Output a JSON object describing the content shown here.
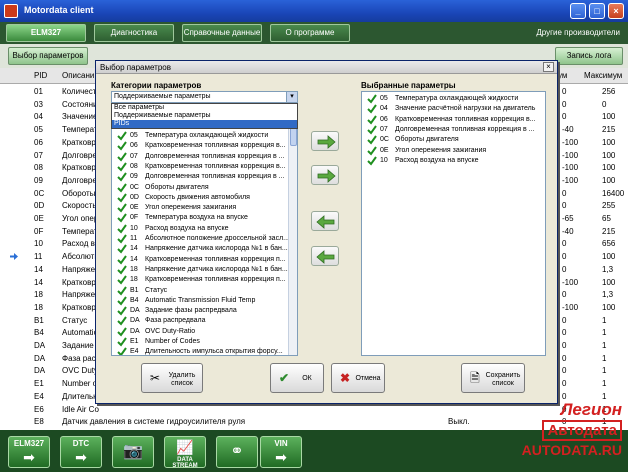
{
  "window": {
    "title": "Motordata client"
  },
  "main_tabs": [
    {
      "label": "ELM327",
      "active": true
    },
    {
      "label": "Диагностика",
      "active": false
    },
    {
      "label": "Справочные данные",
      "active": false
    },
    {
      "label": "О программе",
      "active": false
    }
  ],
  "producers_label": "Другие производители",
  "sub_buttons": {
    "select_params": "Выбор параметров",
    "record_log": "Запись лога"
  },
  "bg_table": {
    "headers": {
      "pid": "PID",
      "desc": "Описани",
      "min": "ум",
      "max": "Максимум"
    },
    "rows": [
      {
        "pid": "01",
        "desc": "Количест",
        "min": "0",
        "max": "256"
      },
      {
        "pid": "03",
        "desc": "Состояни",
        "min": "0",
        "max": "0"
      },
      {
        "pid": "04",
        "desc": "Значение",
        "min": "0",
        "max": "100"
      },
      {
        "pid": "05",
        "desc": "Температу",
        "min": "-40",
        "max": "215"
      },
      {
        "pid": "06",
        "desc": "Кратковре",
        "min": "-100",
        "max": "100"
      },
      {
        "pid": "07",
        "desc": "Долговрем",
        "min": "-100",
        "max": "100"
      },
      {
        "pid": "08",
        "desc": "Кратковре",
        "min": "-100",
        "max": "100"
      },
      {
        "pid": "09",
        "desc": "Долговрем",
        "min": "-100",
        "max": "100"
      },
      {
        "pid": "0C",
        "desc": "Обороты",
        "min": "0",
        "max": "16400"
      },
      {
        "pid": "0D",
        "desc": "Скорость",
        "min": "0",
        "max": "255"
      },
      {
        "pid": "0E",
        "desc": "Угол опер",
        "min": "-65",
        "max": "65"
      },
      {
        "pid": "0F",
        "desc": "Температу",
        "min": "-40",
        "max": "215"
      },
      {
        "pid": "10",
        "desc": "Расход в",
        "min": "0",
        "max": "656"
      },
      {
        "pid": "11",
        "desc": "Абсолютн",
        "min": "0",
        "max": "100"
      },
      {
        "pid": "14",
        "desc": "Напряжен",
        "min": "0",
        "max": "1,3"
      },
      {
        "pid": "14",
        "desc": "Кратковре",
        "min": "-100",
        "max": "100"
      },
      {
        "pid": "18",
        "desc": "Напряжен",
        "min": "0",
        "max": "1,3"
      },
      {
        "pid": "18",
        "desc": "Кратковре",
        "min": "-100",
        "max": "100"
      },
      {
        "pid": "B1",
        "desc": "Статус",
        "min": "0",
        "max": "1"
      },
      {
        "pid": "B4",
        "desc": "Automatic",
        "min": "0",
        "max": "1"
      },
      {
        "pid": "DA",
        "desc": "Задание с",
        "min": "0",
        "max": "1"
      },
      {
        "pid": "DA",
        "desc": "Фаза рас",
        "min": "0",
        "max": "1"
      },
      {
        "pid": "DA",
        "desc": "OVC Duty",
        "min": "0",
        "max": "1"
      },
      {
        "pid": "E1",
        "desc": "Number of",
        "min": "0",
        "max": "1"
      },
      {
        "pid": "E4",
        "desc": "Длительн",
        "min": "0",
        "max": "1"
      },
      {
        "pid": "E6",
        "desc": "Idle Air Co",
        "min": "0",
        "max": "1"
      },
      {
        "pid": "E8",
        "desc": "Датчик давления в системе гидроусилителя руля",
        "state": "Выкл.",
        "min": "0",
        "max": "1"
      }
    ]
  },
  "logo": {
    "line1": "Легион",
    "line2": "Автодата",
    "url": "AUTODATA.RU"
  },
  "bottom_buttons": [
    {
      "label": "ELM327",
      "icon": "arrow-right-icon"
    },
    {
      "label": "DTC",
      "icon": "arrow-right-icon"
    },
    {
      "label": "",
      "icon": "camera-icon"
    },
    {
      "label": "DATA STREAM",
      "icon": "chart-icon"
    },
    {
      "label": "",
      "icon": "link-icon"
    },
    {
      "label": "VIN",
      "icon": "arrow-right-icon"
    }
  ],
  "dialog": {
    "title": "Выбор параметров",
    "categories_label": "Категории параметров",
    "selected_label": "Выбранные параметры",
    "combo_value": "Поддерживаемые параметры",
    "dropdown_options": [
      {
        "label": "Все параметры",
        "selected": false
      },
      {
        "label": "Поддерживаемые параметры",
        "selected": false
      },
      {
        "label": "PIDs",
        "selected": true
      }
    ],
    "left_items": [
      {
        "pid": "05",
        "name": "Температура охлаждающей жидкости"
      },
      {
        "pid": "06",
        "name": "Кратковременная топливная коррекция в..."
      },
      {
        "pid": "07",
        "name": "Долговременная топливная коррекция в ..."
      },
      {
        "pid": "08",
        "name": "Кратковременная топливная коррекция в..."
      },
      {
        "pid": "09",
        "name": "Долговременная топливная коррекция в ..."
      },
      {
        "pid": "0C",
        "name": "Обороты двигателя"
      },
      {
        "pid": "0D",
        "name": "Скорость движения автомобиля"
      },
      {
        "pid": "0E",
        "name": "Угол опережения зажигания"
      },
      {
        "pid": "0F",
        "name": "Температура воздуха на впуске"
      },
      {
        "pid": "10",
        "name": "Расход воздуха на впуске"
      },
      {
        "pid": "11",
        "name": "Абсолютное положение дроссельной засл..."
      },
      {
        "pid": "14",
        "name": "Напряжение датчика кислорода №1 в бан..."
      },
      {
        "pid": "14",
        "name": "Кратковременная топливная коррекция п..."
      },
      {
        "pid": "18",
        "name": "Напряжение датчика кислорода №1 в бан..."
      },
      {
        "pid": "18",
        "name": "Кратковременная топливная коррекция п..."
      },
      {
        "pid": "B1",
        "name": "Статус"
      },
      {
        "pid": "B4",
        "name": "Automatic Transmission Fluid Temp"
      },
      {
        "pid": "DA",
        "name": "Задание фазы распредвала"
      },
      {
        "pid": "DA",
        "name": "Фаза распредвала"
      },
      {
        "pid": "DA",
        "name": "OVC Duty-Ratio"
      },
      {
        "pid": "E1",
        "name": "Number of Codes"
      },
      {
        "pid": "E4",
        "name": "Длительность импульса открытия форсу..."
      }
    ],
    "right_items": [
      {
        "pid": "05",
        "name": "Температура охлаждающей жидкости"
      },
      {
        "pid": "04",
        "name": "Значение расчётной нагрузки на двигатель"
      },
      {
        "pid": "06",
        "name": "Кратковременная топливная коррекция в..."
      },
      {
        "pid": "07",
        "name": "Долговременная топливная коррекция в ..."
      },
      {
        "pid": "0C",
        "name": "Обороты двигателя"
      },
      {
        "pid": "0E",
        "name": "Угол опережения зажигания"
      },
      {
        "pid": "10",
        "name": "Расход воздуха на впуске"
      }
    ],
    "delete_list": "Удалить список",
    "ok": "ОК",
    "cancel": "Отмена",
    "save_list": "Сохранить список"
  },
  "colors": {
    "check": "#1f8f1f",
    "arrow": "#4a9a3a",
    "accent": "#316ac5"
  }
}
